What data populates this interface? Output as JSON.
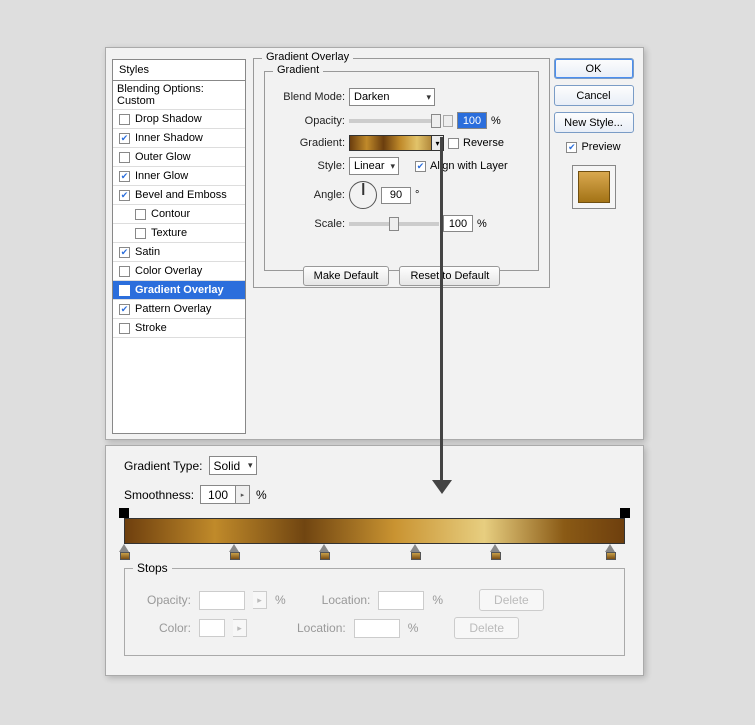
{
  "dialog": {
    "styles_header": "Styles",
    "blending_options": "Blending Options: Custom",
    "items": [
      {
        "label": "Drop Shadow",
        "checked": false
      },
      {
        "label": "Inner Shadow",
        "checked": true
      },
      {
        "label": "Outer Glow",
        "checked": false
      },
      {
        "label": "Inner Glow",
        "checked": true
      },
      {
        "label": "Bevel and Emboss",
        "checked": true
      },
      {
        "label": "Contour",
        "checked": false,
        "sub": true
      },
      {
        "label": "Texture",
        "checked": false,
        "sub": true
      },
      {
        "label": "Satin",
        "checked": true
      },
      {
        "label": "Color Overlay",
        "checked": false
      },
      {
        "label": "Gradient Overlay",
        "checked": true,
        "selected": true
      },
      {
        "label": "Pattern Overlay",
        "checked": true
      },
      {
        "label": "Stroke",
        "checked": false
      }
    ]
  },
  "gradient_overlay": {
    "section_title": "Gradient Overlay",
    "subsection_title": "Gradient",
    "blend_mode_label": "Blend Mode:",
    "blend_mode_value": "Darken",
    "opacity_label": "Opacity:",
    "opacity_value": "100",
    "percent": "%",
    "gradient_label": "Gradient:",
    "reverse_label": "Reverse",
    "reverse_checked": false,
    "style_label": "Style:",
    "style_value": "Linear",
    "align_label": "Align with Layer",
    "align_checked": true,
    "angle_label": "Angle:",
    "angle_value": "90",
    "degree": "°",
    "scale_label": "Scale:",
    "scale_value": "100",
    "make_default": "Make Default",
    "reset_default": "Reset to Default"
  },
  "buttons": {
    "ok": "OK",
    "cancel": "Cancel",
    "new_style": "New Style...",
    "preview": "Preview",
    "preview_checked": true
  },
  "editor": {
    "gradient_type_label": "Gradient Type:",
    "gradient_type_value": "Solid",
    "smoothness_label": "Smoothness:",
    "smoothness_value": "100",
    "percent": "%",
    "opacity_stops_pct": [
      0,
      100
    ],
    "color_stops_pct": [
      0,
      22,
      40,
      58,
      74,
      97
    ],
    "stops_title": "Stops",
    "opacity_label": "Opacity:",
    "location_label": "Location:",
    "color_label": "Color:",
    "delete_label": "Delete",
    "opacity_value": "",
    "location_value": ""
  }
}
